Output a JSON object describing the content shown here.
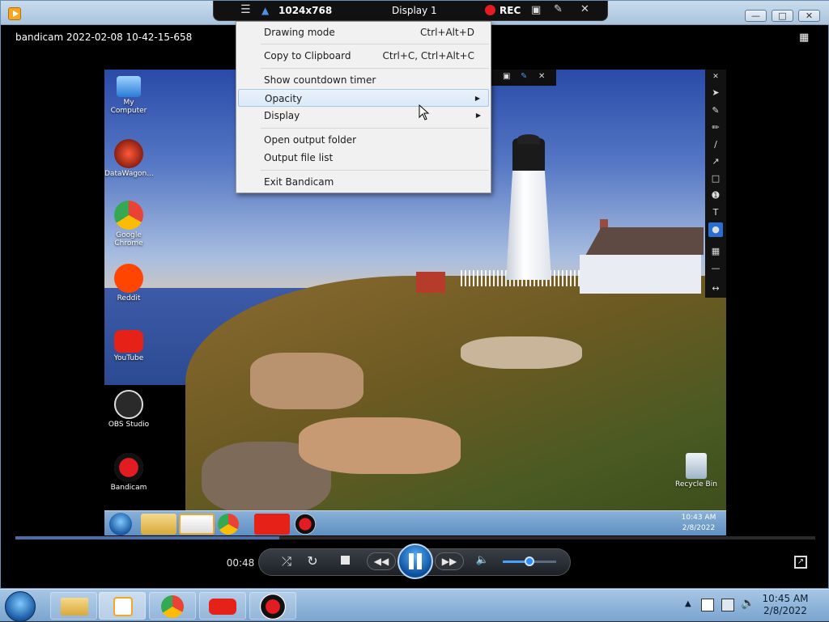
{
  "window": {
    "title": "bandicam 2022-02-08 10-42-15-658"
  },
  "bandicam_bar": {
    "resolution": "1024x768",
    "display": "Display 1",
    "rec": "REC"
  },
  "context_menu": {
    "items": [
      {
        "label": "Drawing mode",
        "shortcut": "Ctrl+Alt+D"
      },
      {
        "label": "Copy to Clipboard",
        "shortcut": "Ctrl+C, Ctrl+Alt+C"
      },
      {
        "label": "Show countdown timer",
        "shortcut": ""
      },
      {
        "label": "Opacity",
        "shortcut": ""
      },
      {
        "label": "Display",
        "shortcut": ""
      },
      {
        "label": "Open output folder",
        "shortcut": ""
      },
      {
        "label": "Output file list",
        "shortcut": ""
      },
      {
        "label": "Exit Bandicam",
        "shortcut": ""
      }
    ]
  },
  "desktop": {
    "icons": [
      {
        "label": "My Computer"
      },
      {
        "label": "DataWagon..."
      },
      {
        "label": "Google Chrome"
      },
      {
        "label": "Reddit"
      },
      {
        "label": "YouTube"
      },
      {
        "label": "OBS Studio"
      },
      {
        "label": "Bandicam"
      },
      {
        "label": "Recycle Bin"
      }
    ],
    "tray_time": "10:43 AM",
    "tray_date": "2/8/2022"
  },
  "player": {
    "elapsed": "00:48",
    "progress": 0.33,
    "volume": 0.5
  },
  "taskbar": {
    "time": "10:45 AM",
    "date": "2/8/2022"
  },
  "colors": {
    "accent": "#1f6fd0",
    "rec_red": "#e31b23"
  }
}
